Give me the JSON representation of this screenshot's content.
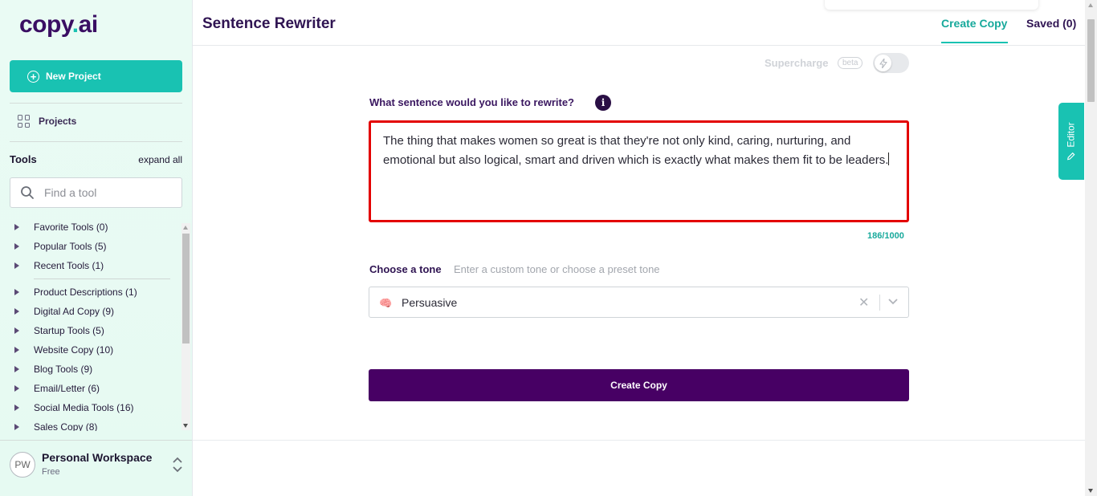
{
  "app": {
    "logo_main": "copy",
    "logo_dot": ".",
    "logo_end": "ai"
  },
  "sidebar": {
    "new_project_label": "New Project",
    "projects_label": "Projects",
    "tools_title": "Tools",
    "expand_all": "expand all",
    "search_placeholder": "Find a tool",
    "tool_groups": [
      {
        "label": "Favorite Tools (0)"
      },
      {
        "label": "Popular Tools (5)"
      },
      {
        "label": "Recent Tools (1)"
      },
      {
        "label": "Product Descriptions (1)"
      },
      {
        "label": "Digital Ad Copy (9)"
      },
      {
        "label": "Startup Tools (5)"
      },
      {
        "label": "Website Copy (10)"
      },
      {
        "label": "Blog Tools (9)"
      },
      {
        "label": "Email/Letter (6)"
      },
      {
        "label": "Social Media Tools (16)"
      },
      {
        "label": "Sales Copy (8)"
      }
    ],
    "workspace": {
      "initials": "PW",
      "name": "Personal Workspace",
      "plan": "Free"
    }
  },
  "header": {
    "title": "Sentence Rewriter",
    "tabs": [
      {
        "label": "Create Copy",
        "active": true
      },
      {
        "label": "Saved (0)",
        "active": false
      }
    ]
  },
  "main": {
    "supercharge_label": "Supercharge",
    "beta_label": "beta",
    "question_label": "What sentence would you like to rewrite?",
    "info_icon": "i",
    "sentence_text": "The thing that makes women so great is that they're not only kind, caring, nurturing, and emotional but also logical, smart and driven which is exactly what makes them fit to be leaders.",
    "char_count": "186/1000",
    "tone_label": "Choose a tone",
    "tone_hint": "Enter a custom tone or choose a preset tone",
    "tone_value": "Persuasive",
    "tone_icon": "brain-icon",
    "create_button": "Create Copy"
  },
  "editor_tab": {
    "label": "Editor"
  },
  "colors": {
    "accent": "#19c2b2",
    "brand": "#470064",
    "highlight": "#e30000"
  }
}
